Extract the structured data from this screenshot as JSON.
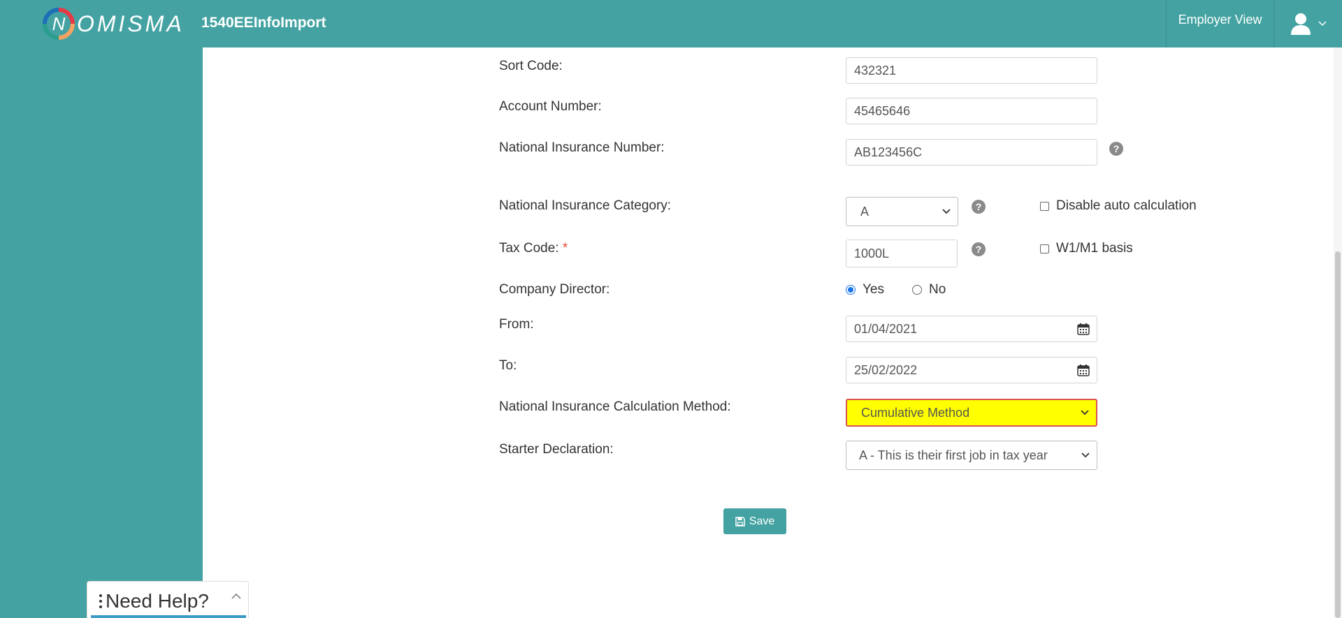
{
  "header": {
    "logo_text": "OMISMA",
    "logo_letter": "N",
    "app_title": "1540EEInfoImport",
    "employer_view_label": "Employer View"
  },
  "form": {
    "sort_code": {
      "label": "Sort Code:",
      "value": "432321"
    },
    "account_number": {
      "label": "Account Number:",
      "value": "45465646"
    },
    "ni_number": {
      "label": "National Insurance Number:",
      "value": "AB123456C"
    },
    "ni_category": {
      "label": "National Insurance Category:",
      "value": "A",
      "disable_auto_label": "Disable auto calculation"
    },
    "tax_code": {
      "label": "Tax Code:",
      "required_mark": "*",
      "value": "1000L",
      "w1m1_label": "W1/M1 basis"
    },
    "company_director": {
      "label": "Company Director:",
      "yes_label": "Yes",
      "no_label": "No",
      "selected": "Yes"
    },
    "from": {
      "label": "From:",
      "value": "01/04/2021"
    },
    "to": {
      "label": "To:",
      "value": "25/02/2022"
    },
    "ni_calc_method": {
      "label": "National Insurance Calculation Method:",
      "value": "Cumulative Method"
    },
    "starter_declaration": {
      "label": "Starter Declaration:",
      "value": "A - This is their first job in tax year"
    },
    "help_glyph": "?",
    "save_label": "Save"
  },
  "help_widget": {
    "title": "Need Help?"
  },
  "colors": {
    "brand_teal": "#44a3a2",
    "highlight_yellow": "#ffff00",
    "highlight_border": "#d9534f",
    "required_red": "#e74c3c"
  },
  "icons": {
    "calendar": "calendar-icon",
    "help": "help-icon",
    "save": "floppy-disk-icon",
    "user": "user-icon"
  }
}
